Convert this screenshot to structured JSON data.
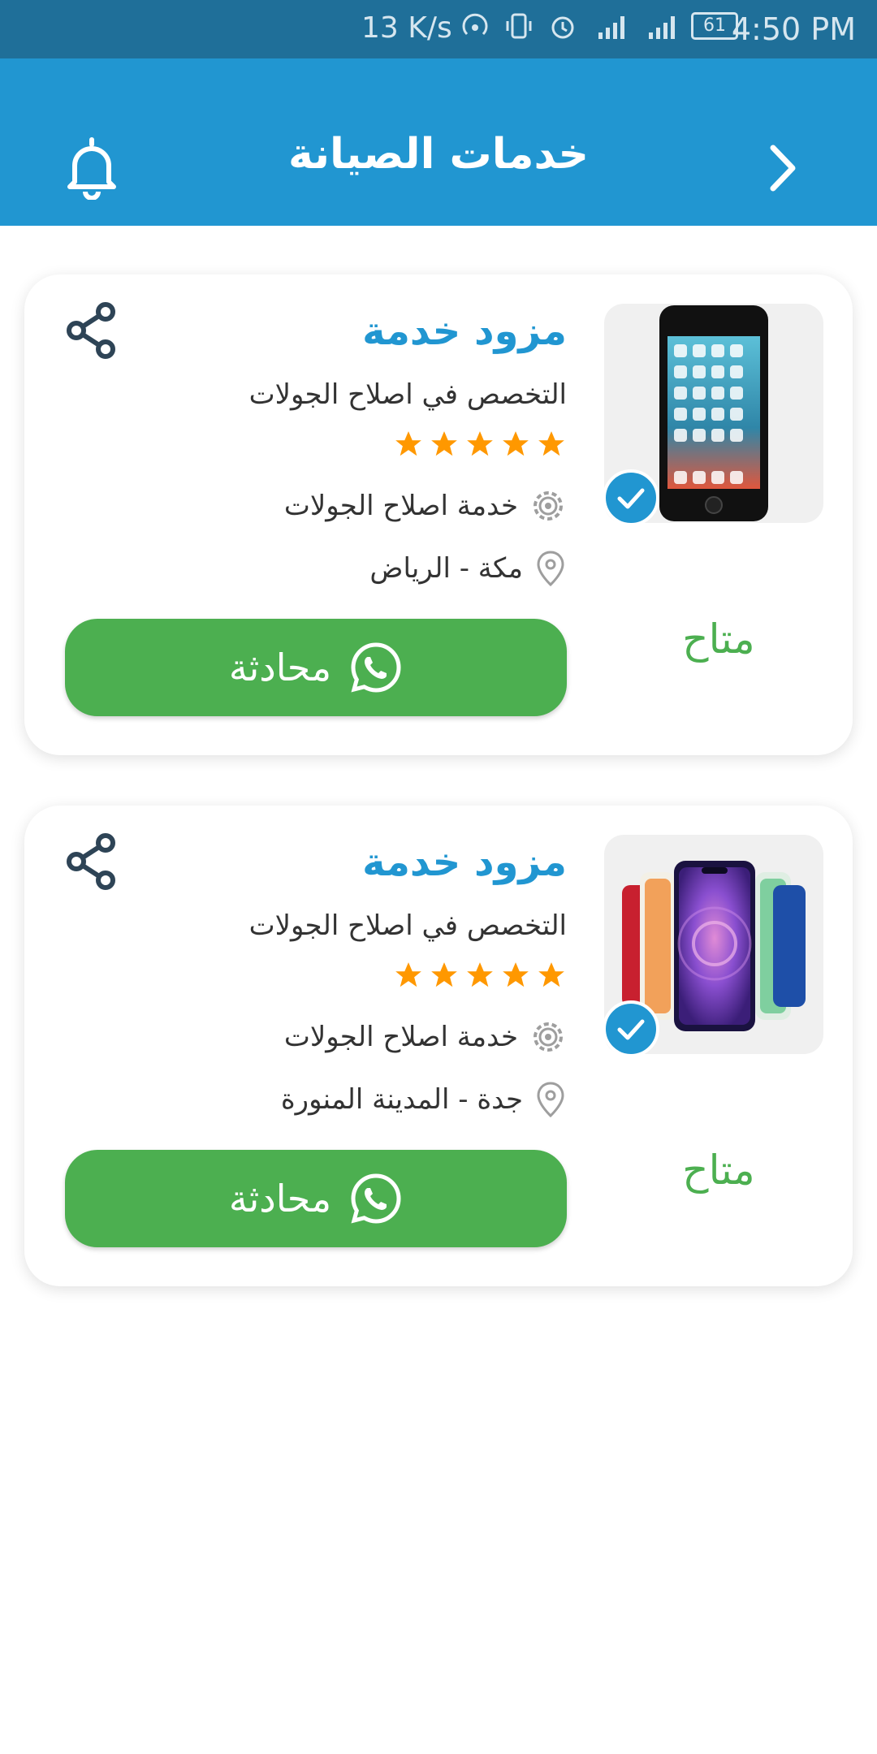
{
  "status_bar": {
    "speed": "13 K/s",
    "battery": "61",
    "time": "4:50 PM"
  },
  "header": {
    "title": "خدمات الصيانة"
  },
  "cards": [
    {
      "name": "مزود خدمة",
      "specialty": "التخصص في اصلاح الجولات",
      "rating": 5,
      "service": "خدمة اصلاح الجولات",
      "location": "مكة  -  الرياض",
      "chat_label": "محادثة",
      "availability": "متاح",
      "image": "single-phone"
    },
    {
      "name": "مزود خدمة",
      "specialty": "التخصص في اصلاح الجولات",
      "rating": 5,
      "service": "خدمة اصلاح الجولات",
      "location": "جدة  -  المدينة المنورة",
      "chat_label": "محادثة",
      "availability": "متاح",
      "image": "phone-lineup"
    }
  ],
  "colors": {
    "status_bar": "#1f6f99",
    "app_bar": "#2196d1",
    "accent": "#2196d1",
    "chat_button": "#4caf50",
    "available": "#4caf50",
    "star": "#ff9800"
  }
}
